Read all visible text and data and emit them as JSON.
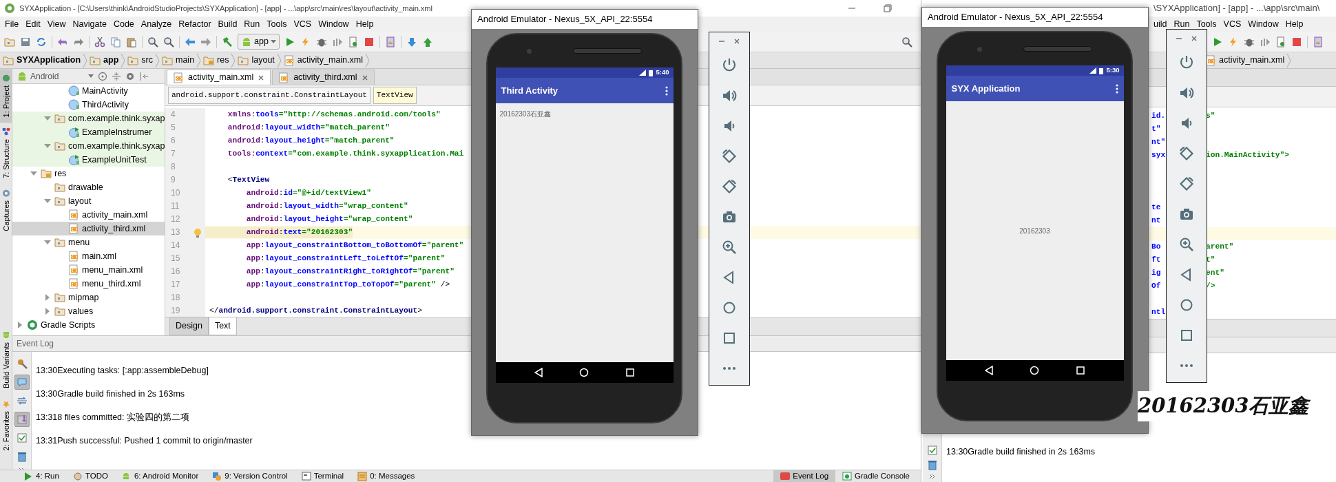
{
  "ide": {
    "title": "SYXApplication - [C:\\Users\\think\\AndroidStudioProjects\\SYXApplication] - [app] - ...\\app\\src\\main\\res\\layout\\activity_main.xml",
    "menu": [
      "File",
      "Edit",
      "View",
      "Navigate",
      "Code",
      "Analyze",
      "Refactor",
      "Build",
      "Run",
      "Tools",
      "VCS",
      "Window",
      "Help"
    ],
    "run_config": "app",
    "breadcrumb": [
      "SYXApplication",
      "app",
      "src",
      "main",
      "res",
      "layout",
      "activity_main.xml"
    ],
    "side_tabs": [
      {
        "label": "1: Project",
        "selected": true,
        "kind": "project"
      },
      {
        "label": "7: Structure",
        "selected": false,
        "kind": "structure"
      },
      {
        "label": "Captures",
        "selected": false,
        "kind": "captures"
      }
    ],
    "side_tabs_bottom": [
      {
        "label": "Build Variants",
        "selected": false,
        "kind": "android"
      },
      {
        "label": "2: Favorites",
        "selected": false,
        "kind": "star"
      }
    ],
    "project_view": "Android",
    "tree": [
      {
        "kind": "offscreen",
        "children": [
          {
            "kind": "offscreen",
            "children": [
              {
                "kind": "offscreen",
                "children": [
                  {
                    "label": "MainActivity",
                    "kind": "class",
                    "selected": false
                  },
                  {
                    "label": "ThirdActivity",
                    "kind": "class",
                    "selected": false
                  }
                ]
              },
              {
                "label": "com.example.think.syxap",
                "kind": "test-package",
                "expanded": true,
                "selected": false,
                "children": [
                  {
                    "label": "ExampleInstrumer",
                    "kind": "test-class",
                    "selected": false
                  }
                ]
              },
              {
                "label": "com.example.think.syxap",
                "kind": "test-package",
                "expanded": true,
                "selected": false,
                "children": [
                  {
                    "label": "ExampleUnitTest",
                    "kind": "test-class",
                    "selected": false
                  }
                ]
              }
            ]
          },
          {
            "label": "res",
            "kind": "res-folder",
            "expanded": true,
            "selected": false,
            "children": [
              {
                "label": "drawable",
                "kind": "folder",
                "selected": false
              },
              {
                "label": "layout",
                "kind": "folder",
                "expanded": true,
                "selected": false,
                "children": [
                  {
                    "label": "activity_main.xml",
                    "kind": "xml",
                    "selected": false
                  },
                  {
                    "label": "activity_third.xml",
                    "kind": "xml",
                    "selected": true
                  }
                ]
              },
              {
                "label": "menu",
                "kind": "folder",
                "expanded": true,
                "selected": false,
                "children": [
                  {
                    "label": "main.xml",
                    "kind": "xml",
                    "selected": false
                  },
                  {
                    "label": "menu_main.xml",
                    "kind": "xml",
                    "selected": false
                  },
                  {
                    "label": "menu_third.xml",
                    "kind": "xml",
                    "selected": false
                  }
                ]
              },
              {
                "label": "mipmap",
                "kind": "folder",
                "expanded": false,
                "selected": false
              },
              {
                "label": "values",
                "kind": "folder",
                "expanded": false,
                "selected": false
              }
            ]
          }
        ]
      },
      {
        "label": "Gradle Scripts",
        "kind": "gradle",
        "expanded": false,
        "selected": false
      }
    ],
    "editor_tabs": [
      {
        "label": "activity_main.xml",
        "selected": true
      },
      {
        "label": "activity_third.xml",
        "selected": false
      }
    ],
    "tag_path": [
      {
        "label": "android.support.constraint.ConstraintLayout",
        "selected": false
      },
      {
        "label": "TextView",
        "selected": true
      }
    ],
    "code_lines": [
      {
        "number": "4",
        "text": "    xmlns:tools=\"http://schemas.android.com/tools\"",
        "current": false
      },
      {
        "number": "5",
        "text": "    android:layout_width=\"match_parent\"",
        "current": false
      },
      {
        "number": "6",
        "text": "    android:layout_height=\"match_parent\"",
        "current": false
      },
      {
        "number": "7",
        "text": "    tools:context=\"com.example.think.syxapplication.Mai",
        "current": false
      },
      {
        "number": "8",
        "current": false
      },
      {
        "number": "9",
        "text": "    <TextView",
        "current": false
      },
      {
        "number": "10",
        "text": "        android:id=\"@+id/textView1\"",
        "current": false
      },
      {
        "number": "11",
        "text": "        android:layout_width=\"wrap_content\"",
        "current": false
      },
      {
        "number": "12",
        "text": "        android:layout_height=\"wrap_content\"",
        "current": false
      },
      {
        "number": "13",
        "text": "        android:text=\"20162303\"",
        "current": true
      },
      {
        "number": "14",
        "text": "        app:layout_constraintBottom_toBottomOf=\"parent\"",
        "current": false
      },
      {
        "number": "15",
        "text": "        app:layout_constraintLeft_toLeftOf=\"parent\"",
        "current": false
      },
      {
        "number": "16",
        "text": "        app:layout_constraintRight_toRightOf=\"parent\"",
        "current": false
      },
      {
        "number": "17",
        "text": "        app:layout_constraintTop_toTopOf=\"parent\" />",
        "current": false
      },
      {
        "number": "18",
        "current": false
      },
      {
        "number": "19",
        "text": "</android.support.constraint.ConstraintLayout>",
        "current": false
      }
    ],
    "view_tabs": [
      {
        "label": "Design",
        "selected": false
      },
      {
        "label": "Text",
        "selected": true
      }
    ],
    "event_log": {
      "title": "Event Log",
      "toggles": [
        {
          "kind": "settings",
          "on": false
        },
        {
          "kind": "balloon",
          "on": true
        },
        {
          "kind": "arrows",
          "on": false
        },
        {
          "kind": "import",
          "on": true
        },
        {
          "kind": "check",
          "on": false
        },
        {
          "kind": "trash",
          "on": false
        }
      ],
      "entries": [
        {
          "time": "13:30",
          "message": "Executing tasks: [:app:assembleDebug]"
        },
        {
          "time": "13:30",
          "message": "Gradle build finished in 2s 163ms"
        },
        {
          "time": "13:31",
          "message": "8 files committed: 实验四的第二项"
        },
        {
          "time": "13:31",
          "message": "Push successful: Pushed 1 commit to origin/master"
        }
      ]
    },
    "tool_windows_left": [
      {
        "label": "4: Run",
        "kind": "run",
        "selected": false
      },
      {
        "label": "TODO",
        "kind": "todo",
        "selected": false
      },
      {
        "label": "6: Android Monitor",
        "kind": "android",
        "selected": false
      },
      {
        "label": "9: Version Control",
        "kind": "vcs",
        "selected": false
      },
      {
        "label": "Terminal",
        "kind": "terminal",
        "selected": false
      },
      {
        "label": "0: Messages",
        "kind": "messages",
        "selected": false
      }
    ],
    "tool_windows_right": [
      {
        "label": "Event Log",
        "kind": "eventlog",
        "selected": true
      },
      {
        "label": "Gradle Console",
        "kind": "gradle",
        "selected": false
      }
    ]
  },
  "emulators": [
    {
      "title": "Android Emulator - Nexus_5X_API_22:5554",
      "clock": "5:40",
      "app_title": "Third Activity",
      "text": "20162303石亚鑫",
      "kind": "topleft"
    },
    {
      "title": "Android Emulator - Nexus_5X_API_22:5554",
      "clock": "5:30",
      "app_title": "SYX Application",
      "text": "20162303",
      "kind": "centered"
    }
  ],
  "ide_behind": {
    "title": "\\SYXApplication] - [app] - ...\\app\\src\\main\\",
    "menu": [
      "uild",
      "Run",
      "Tools",
      "VCS",
      "Window",
      "Help"
    ],
    "breadcrumb": "activity_main.xml",
    "code_rows": [
      {
        "left": "id.",
        "right": "s\"",
        "current": false
      },
      {
        "left": "t\"",
        "current": false
      },
      {
        "left": "nt\"",
        "current": false
      },
      {
        "left": "syx",
        "right": "ion.MainActivity\">",
        "current": false
      },
      {
        "current": false
      },
      {
        "current": false
      },
      {
        "current": false
      },
      {
        "left": "te",
        "current": false
      },
      {
        "left": "nt",
        "current": false
      },
      {
        "current": true
      },
      {
        "left": "Bo",
        "right": "arent\"",
        "current": false
      },
      {
        "left": "ft",
        "right": "t\"",
        "current": false
      },
      {
        "left": "ig",
        "right": "ent\"",
        "current": false
      },
      {
        "left": "Of",
        "right": "/>",
        "current": false
      },
      {
        "current": false
      },
      {
        "left": "ntl",
        "current": false
      }
    ],
    "log_entry": {
      "time": "13:30",
      "message": "Gradle build finished in 2s 163ms"
    }
  },
  "signature": "20162303石亚鑫"
}
